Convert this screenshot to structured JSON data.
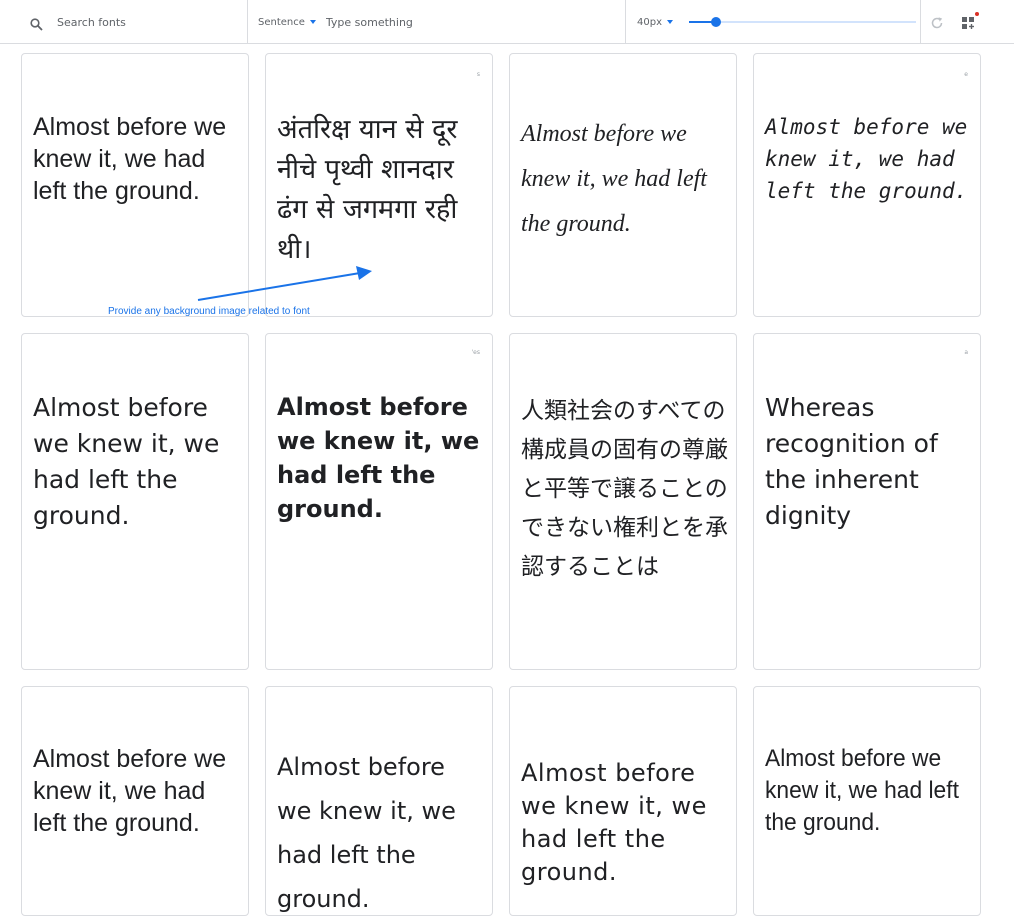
{
  "toolbar": {
    "search": {
      "icon": "search-icon",
      "placeholder": "Search fonts"
    },
    "text": {
      "mode_label": "Sentence",
      "placeholder": "Type something"
    },
    "size": {
      "label": "40px",
      "slider_level": 0.12
    },
    "actions": {
      "refresh_icon": "refresh-icon",
      "grid_icon": "grid-add-icon"
    }
  },
  "annotation": {
    "text": "Provide any background image related to font",
    "color": "#1a73e8"
  },
  "cards": {
    "c1": {
      "sample": "Almost before we knew it, we had left the ground."
    },
    "c2": {
      "sample": "अंतरिक्ष यान से दूर नीचे पृथ्वी शानदार ढंग से जगमगा रही थी।"
    },
    "c3": {
      "sample": "Almost before we knew it, we had left the ground."
    },
    "c4": {
      "sample": "Almost before we knew it, we had left the ground."
    },
    "c5": {
      "sample": "Almost before we knew it, we had left the ground."
    },
    "c6": {
      "sample": "Almost before we knew it, we had left the ground."
    },
    "c7": {
      "sample": "人類社会のすべての構成員の固有の尊厳と平等で譲ることのできない権利とを承認することは"
    },
    "c8": {
      "sample": "Whereas recognition of the inherent dignity"
    },
    "c9": {
      "sample": "Almost before we knew it, we had left the ground."
    },
    "c10": {
      "sample": "Almost before we knew it, we had left the ground."
    },
    "c11": {
      "sample": "Almost before we knew it, we had left the ground."
    },
    "c12": {
      "sample": "Almost before we knew it, we had left the ground."
    }
  },
  "colors": {
    "accent": "#1a73e8",
    "border": "#dadce0",
    "text": "#202124",
    "muted": "#5f6368",
    "notification": "#d93025"
  }
}
